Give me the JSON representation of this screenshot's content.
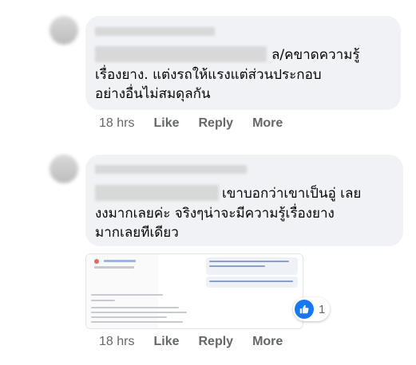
{
  "comments": [
    {
      "lines": [
        "ล/คขาดความรู้",
        "เรื่องยาง. แต่งรถให้แรงแต่ส่วนประกอบ",
        "อย่างอื่นไม่สมดุลกัน"
      ],
      "time": "18 hrs",
      "like_label": "Like",
      "reply_label": "Reply",
      "more_label": "More"
    },
    {
      "lines": [
        "เขาบอกว่าเขาเป็นอู่ เลย",
        "งงมากเลยค่ะ จริงๆน่าจะมีความรู้เรื่องยาง",
        "มากเลยทีเดียว"
      ],
      "time": "18 hrs",
      "like_label": "Like",
      "reply_label": "Reply",
      "more_label": "More",
      "reaction": {
        "icon": "thumbs-up-icon",
        "count": "1",
        "color": "#1877f2"
      }
    }
  ],
  "colors": {
    "bubble": "#f0f2f5",
    "meta": "#65676b",
    "text": "#050505"
  }
}
